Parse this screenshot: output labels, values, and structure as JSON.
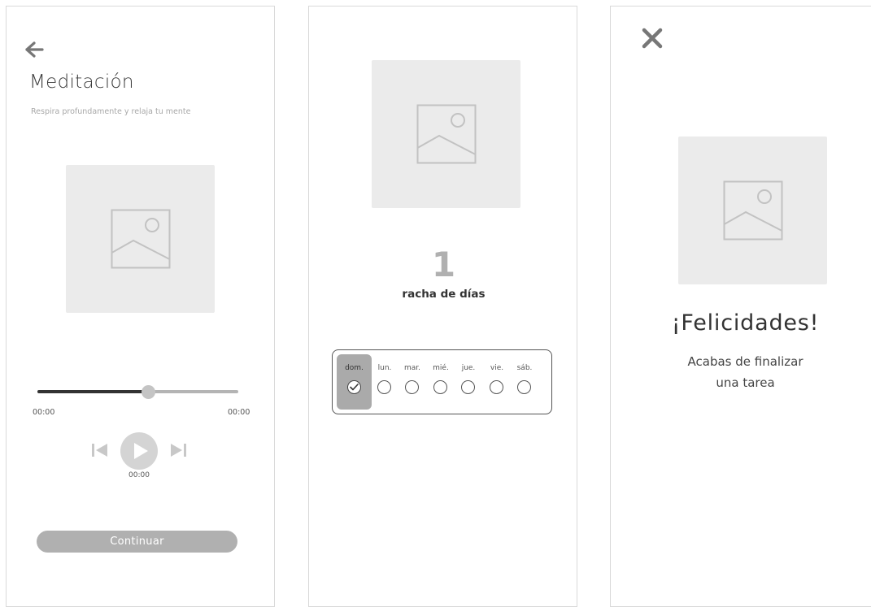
{
  "meditation": {
    "title": "Meditación",
    "subtitle": "Respira profundamente y relaja tu mente",
    "player": {
      "time_start": "00:00",
      "time_end": "00:00",
      "time_current": "00:00",
      "progress": 0.55
    },
    "continue_label": "Continuar"
  },
  "streak": {
    "number": "1",
    "label": "racha de días",
    "days": [
      {
        "label": "dom.",
        "checked": true
      },
      {
        "label": "lun.",
        "checked": false
      },
      {
        "label": "mar.",
        "checked": false
      },
      {
        "label": "mié.",
        "checked": false
      },
      {
        "label": "jue.",
        "checked": false
      },
      {
        "label": "vie.",
        "checked": false
      },
      {
        "label": "sáb.",
        "checked": false
      }
    ]
  },
  "completion": {
    "title": "¡Felicidades!",
    "message_line1": "Acabas de finalizar",
    "message_line2": "una tarea"
  },
  "icons": {
    "back": "arrow-left-icon",
    "close": "close-icon",
    "image": "image-placeholder-icon",
    "play": "play-icon",
    "prev": "skip-previous-icon",
    "next": "skip-next-icon",
    "check": "check-icon"
  },
  "colors": {
    "placeholder_bg": "#ebebeb",
    "accent_gray": "#b0b0b0",
    "text_dark": "#333333"
  }
}
